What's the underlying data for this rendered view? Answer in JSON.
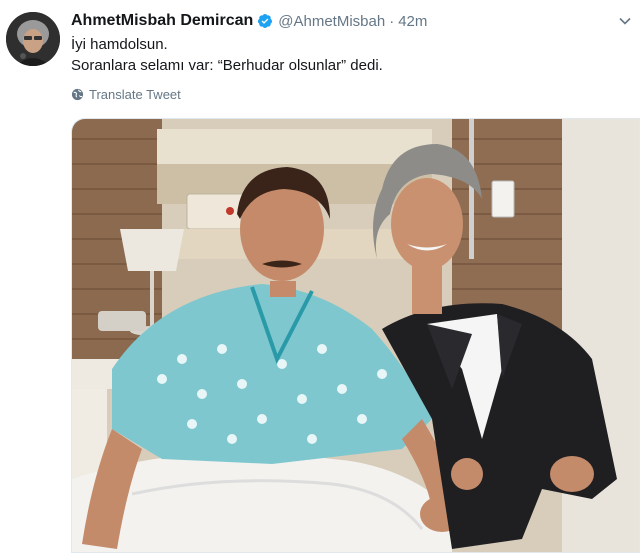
{
  "author": {
    "display_name": "AhmetMisbah Demircan",
    "handle": "@AhmetMisbah",
    "separator": "·",
    "time_ago": "42m"
  },
  "tweet": {
    "line1": "İyi hamdolsun.",
    "line2": "Soranlara selamı var: “Berhudar olsunlar” dedi."
  },
  "translate_label": "Translate Tweet",
  "icons": [
    "verified-badge-icon",
    "caret-down-icon",
    "globe-icon"
  ],
  "colors": {
    "verified": "#1da1f2",
    "secondary_text": "#657786",
    "primary_text": "#14171a"
  }
}
